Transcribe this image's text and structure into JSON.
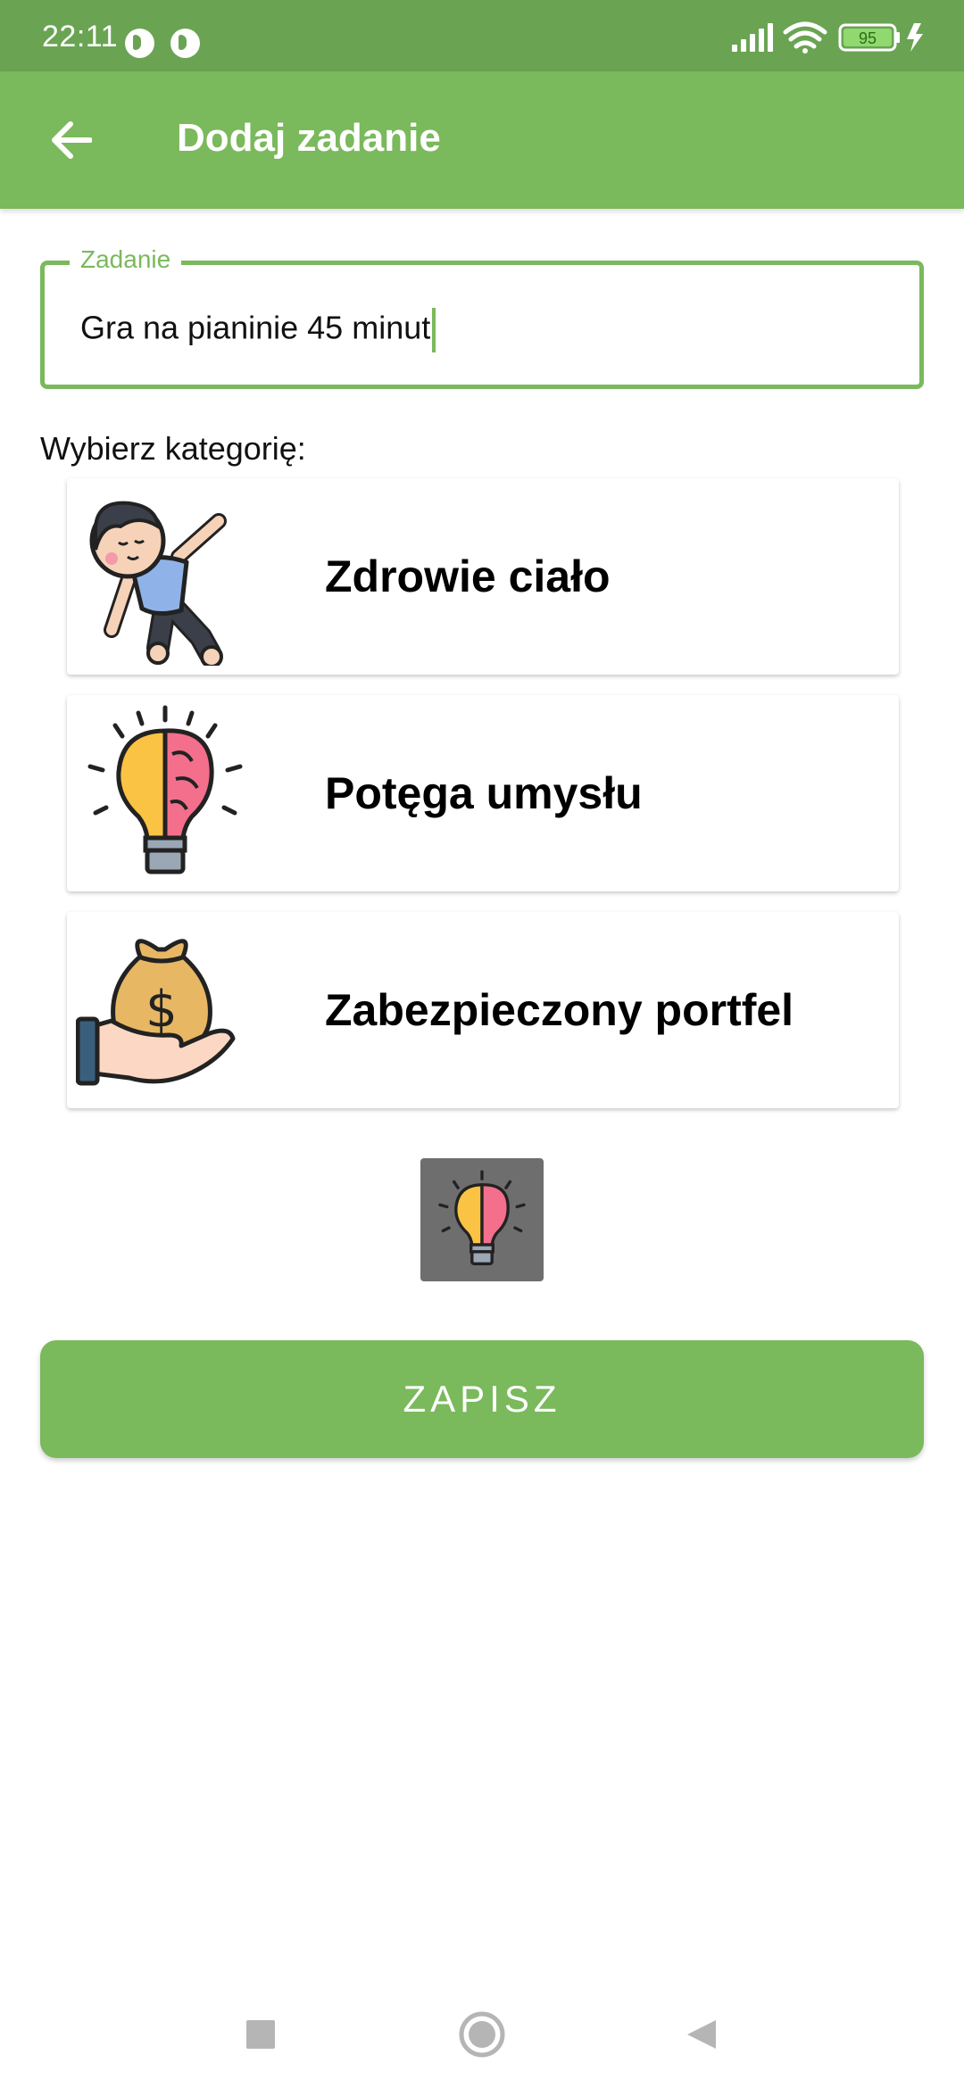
{
  "status_bar": {
    "time": "22:11",
    "battery": "95"
  },
  "app_bar": {
    "title": "Dodaj zadanie",
    "back_icon": "arrow-back-icon"
  },
  "task_field": {
    "label": "Zadanie",
    "value": "Gra na pianinie 45 minut"
  },
  "category_section": {
    "heading": "Wybierz kategorię:",
    "items": [
      {
        "label": "Zdrowie ciało",
        "icon": "stretching-kid-icon"
      },
      {
        "label": "Potęga umysłu",
        "icon": "brain-lightbulb-icon"
      },
      {
        "label": "Zabezpieczony portfel",
        "icon": "money-bag-hand-icon"
      }
    ],
    "selected_icon": "brain-lightbulb-icon"
  },
  "save_button": {
    "label": "ZAPISZ"
  },
  "colors": {
    "status_bar": "#6aa453",
    "primary": "#7ab95c",
    "preview_bg": "#6e6e6e"
  }
}
